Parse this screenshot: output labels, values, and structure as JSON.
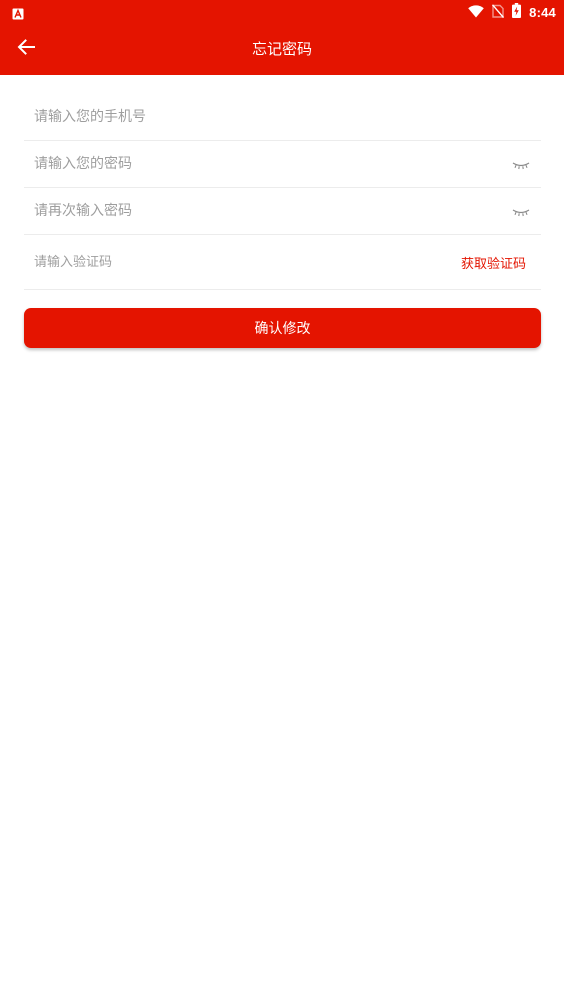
{
  "status_bar": {
    "time": "8:44",
    "left_icon": "app-notification-icon",
    "icons": [
      "wifi-icon",
      "no-sim-icon",
      "battery-charging-icon"
    ]
  },
  "app_bar": {
    "title": "忘记密码",
    "back_icon": "arrow-back-icon"
  },
  "form": {
    "phone_placeholder": "请输入您的手机号",
    "password_placeholder": "请输入您的密码",
    "password_confirm_placeholder": "请再次输入密码",
    "code_placeholder": "请输入验证码",
    "get_code_label": "获取验证码",
    "eye_icon": "eye-closed-icon"
  },
  "submit_label": "确认修改",
  "colors": {
    "primary": "#e41400",
    "background": "#ffffff",
    "placeholder": "#9e9e9e",
    "divider": "#ececec"
  }
}
